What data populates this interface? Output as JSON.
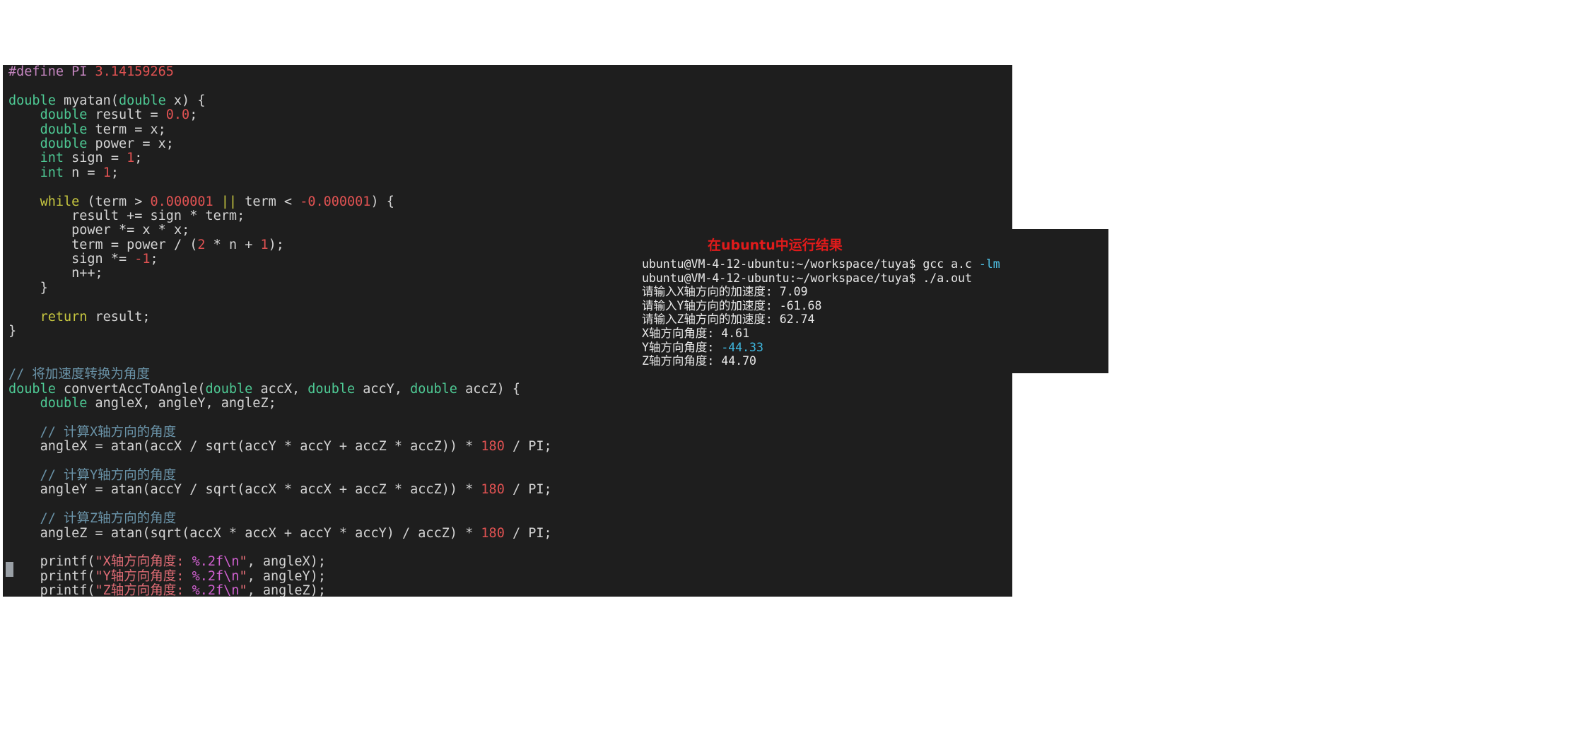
{
  "editor": {
    "language": "c",
    "background_color": "#1e1e1e",
    "cursor_marker_color": "#9aa0a6",
    "code_lines": [
      "#define PI 3.14159265",
      "",
      "double myatan(double x) {",
      "    double result = 0.0;",
      "    double term = x;",
      "    double power = x;",
      "    int sign = 1;",
      "    int n = 1;",
      "",
      "    while (term > 0.000001 || term < -0.000001) {",
      "        result += sign * term;",
      "        power *= x * x;",
      "        term = power / (2 * n + 1);",
      "        sign *= -1;",
      "        n++;",
      "    }",
      "",
      "    return result;",
      "}",
      "",
      "",
      "// 将加速度转换为角度",
      "double convertAccToAngle(double accX, double accY, double accZ) {",
      "    double angleX, angleY, angleZ;",
      "",
      "    // 计算X轴方向的角度",
      "    angleX = atan(accX / sqrt(accY * accY + accZ * accZ)) * 180 / PI;",
      "",
      "    // 计算Y轴方向的角度",
      "    angleY = atan(accY / sqrt(accX * accX + accZ * accZ)) * 180 / PI;",
      "",
      "    // 计算Z轴方向的角度",
      "    angleZ = atan(sqrt(accX * accX + accY * accY) / accZ) * 180 / PI;",
      "",
      "    printf(\"X轴方向角度: %.2f\\n\", angleX);",
      "    printf(\"Y轴方向角度: %.2f\\n\", angleY);",
      "    printf(\"Z轴方向角度: %.2f\\n\", angleZ);"
    ],
    "colors": {
      "preprocessor": "#c586c0",
      "type_keyword": "#4ec994",
      "control_keyword": "#c8c840",
      "number": "#e05252",
      "comment": "#6a93a8",
      "string": "#e06c75",
      "format_specifier": "#d060d0",
      "identifier": "#d4d4d4"
    }
  },
  "terminal": {
    "title": "在ubuntu中运行结果",
    "title_color": "#e01b1b",
    "background_color": "#1e1e1e",
    "prompt": "ubuntu@VM-4-12-ubuntu:~/workspace/tuya$",
    "lines": [
      {
        "segments": [
          {
            "text": "ubuntu@VM-4-12-ubuntu:~/workspace/tuya$ gcc a.c ",
            "style": "normal"
          },
          {
            "text": "-lm",
            "style": "flag"
          }
        ]
      },
      {
        "segments": [
          {
            "text": "ubuntu@VM-4-12-ubuntu:~/workspace/tuya$ ./a.out",
            "style": "normal"
          }
        ]
      },
      {
        "segments": [
          {
            "text": "请输入X轴方向的加速度: 7.09",
            "style": "normal"
          }
        ]
      },
      {
        "segments": [
          {
            "text": "请输入Y轴方向的加速度: -61.68",
            "style": "normal"
          }
        ]
      },
      {
        "segments": [
          {
            "text": "请输入Z轴方向的加速度: 62.74",
            "style": "normal"
          }
        ]
      },
      {
        "segments": [
          {
            "text": "X轴方向角度: 4.61",
            "style": "normal"
          }
        ]
      },
      {
        "segments": [
          {
            "text": "Y轴方向角度: ",
            "style": "normal"
          },
          {
            "text": "-44.33",
            "style": "highlight"
          }
        ]
      },
      {
        "segments": [
          {
            "text": "Z轴方向角度: 44.70",
            "style": "normal"
          }
        ]
      }
    ],
    "flag_color": "#4fc3e8",
    "highlight_color": "#3fb8e0",
    "inputs": {
      "accX": "7.09",
      "accY": "-61.68",
      "accZ": "62.74"
    },
    "outputs": {
      "angleX": "4.61",
      "angleY": "-44.33",
      "angleZ": "44.70"
    },
    "commands": [
      "gcc a.c -lm",
      "./a.out"
    ]
  }
}
